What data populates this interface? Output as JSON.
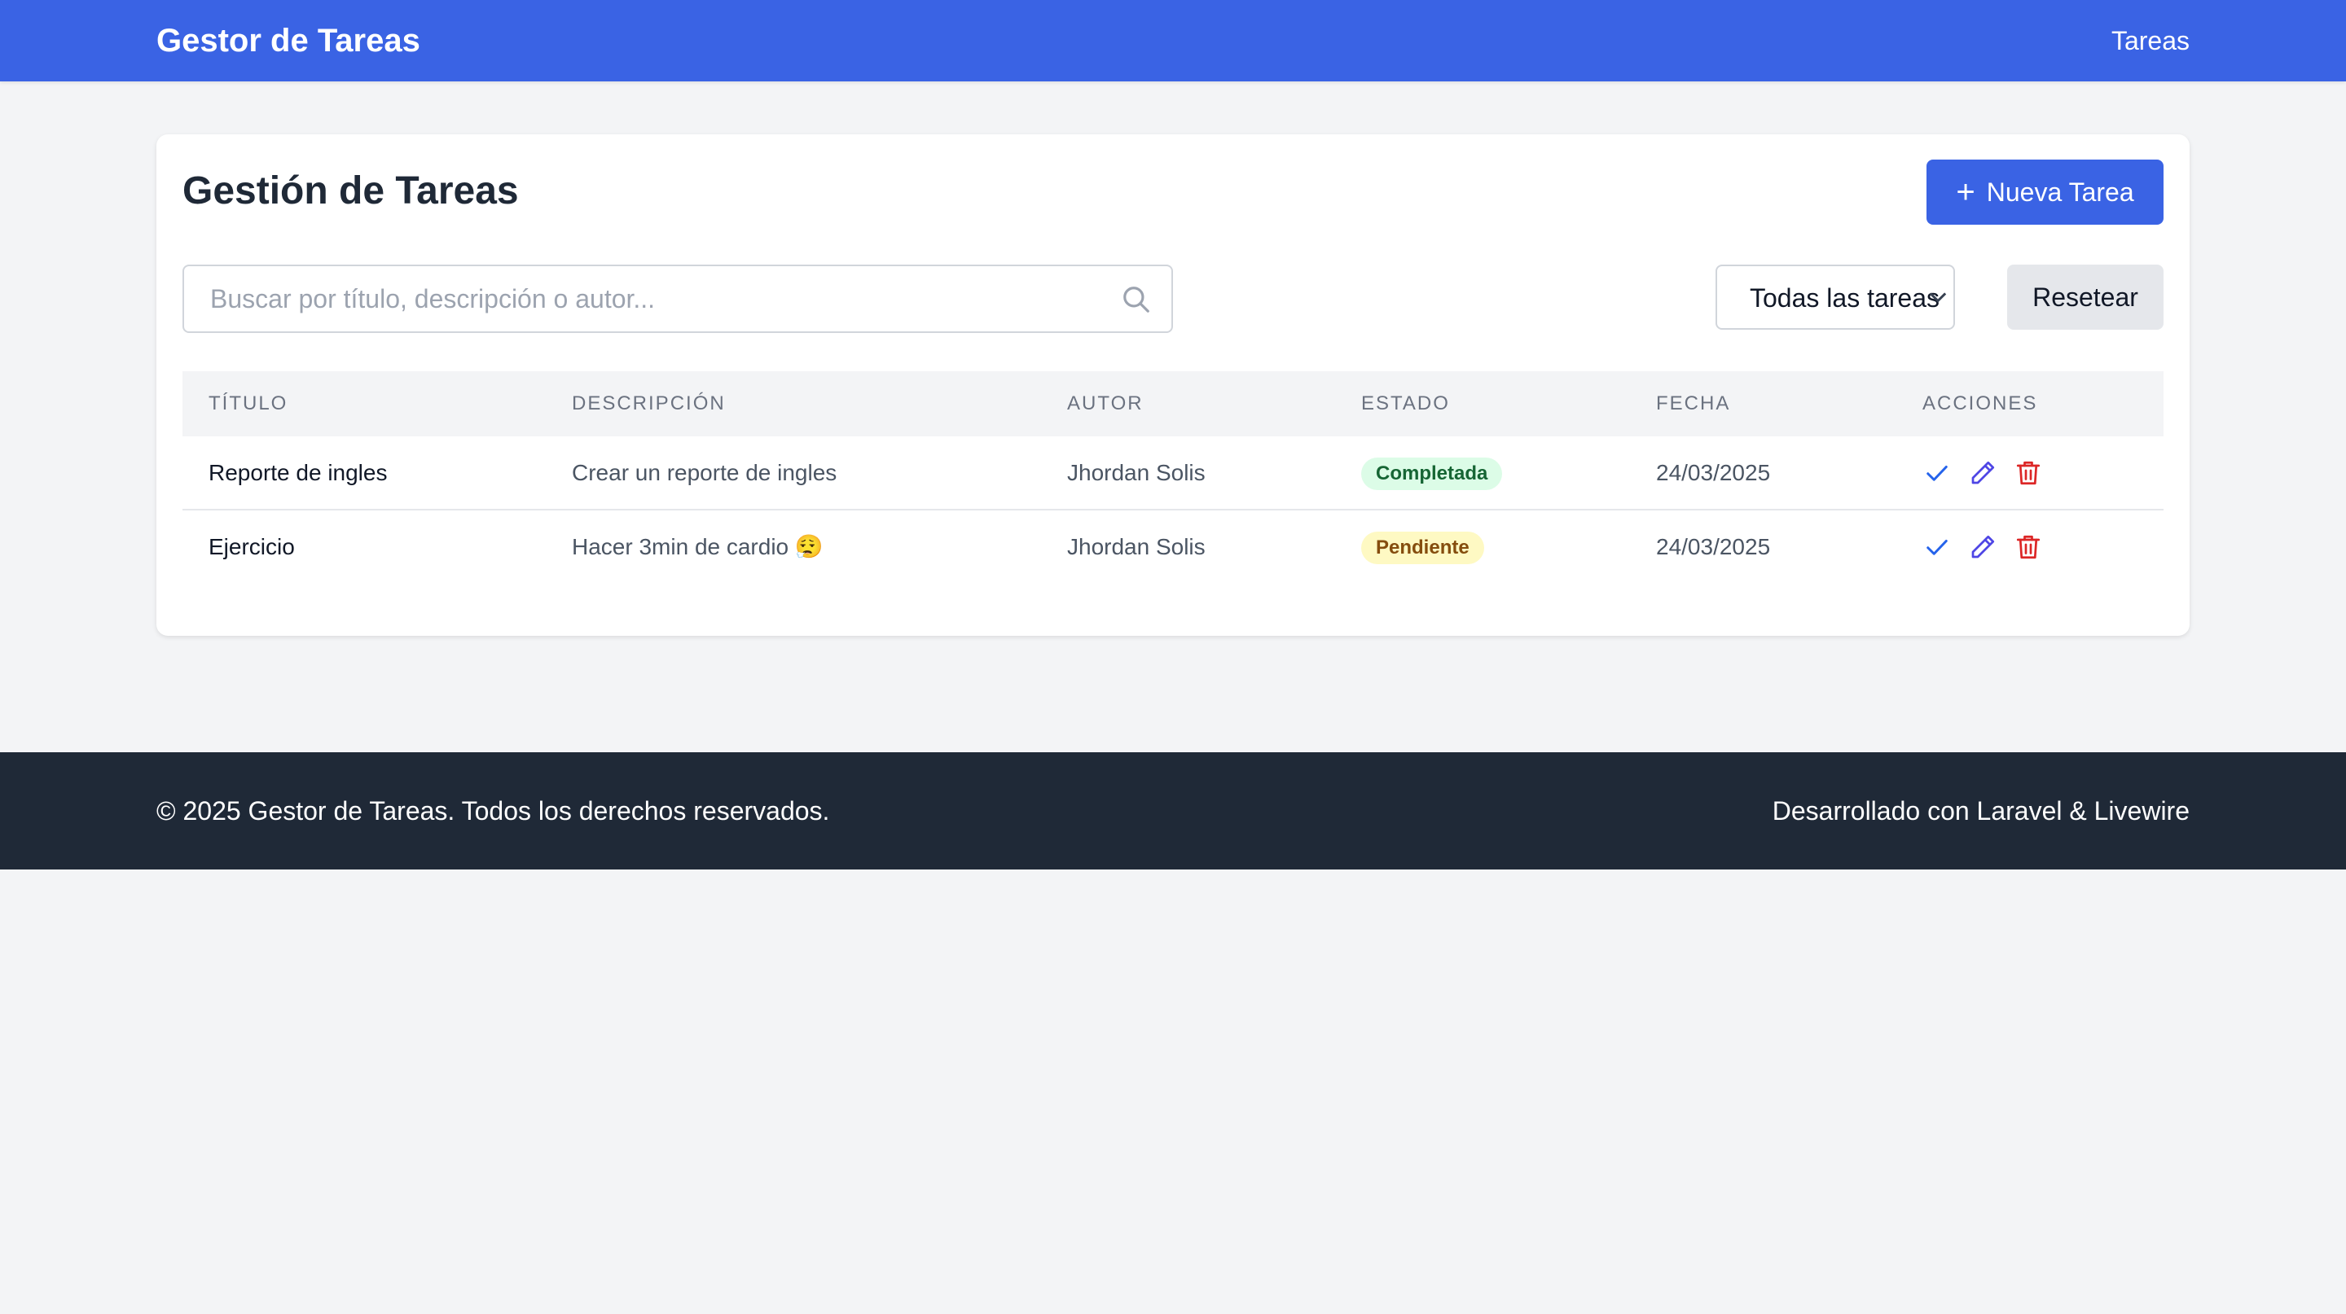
{
  "navbar": {
    "brand": "Gestor de Tareas",
    "link": "Tareas"
  },
  "main": {
    "title": "Gestión de Tareas",
    "new_button_icon": "plus-icon",
    "new_button_label": "Nueva Tarea",
    "search": {
      "value": "",
      "placeholder": "Buscar por título, descripción o autor...",
      "icon": "search-icon"
    },
    "filter": {
      "selected": "Todas las tareas"
    },
    "reset_label": "Resetear"
  },
  "table": {
    "headers": {
      "title": "TÍTULO",
      "description": "DESCRIPCIÓN",
      "author": "AUTOR",
      "status": "ESTADO",
      "date": "FECHA",
      "actions": "ACCIONES"
    },
    "rows": [
      {
        "title": "Reporte de ingles",
        "description": "Crear un reporte de ingles",
        "author": "Jhordan Solis",
        "status": "Completada",
        "date": "24/03/2025"
      },
      {
        "title": "Ejercicio",
        "description": "Hacer 3min de cardio 😮‍💨",
        "author": "Jhordan Solis",
        "status": "Pendiente",
        "date": "24/03/2025"
      }
    ],
    "action_icons": [
      "check-icon",
      "pencil-icon",
      "trash-icon"
    ]
  },
  "footer": {
    "left": "© 2025 Gestor de Tareas. Todos los derechos reservados.",
    "right": "Desarrollado con Laravel & Livewire"
  },
  "colors": {
    "primary": "#3a63e4",
    "footer_bg": "#1f2937",
    "completed_bg": "#dcfce7",
    "completed_text": "#166534",
    "pending_bg": "#fef9c3",
    "pending_text": "#854d0e",
    "check": "#2563eb",
    "edit": "#4f46e5",
    "delete": "#dc2626"
  }
}
